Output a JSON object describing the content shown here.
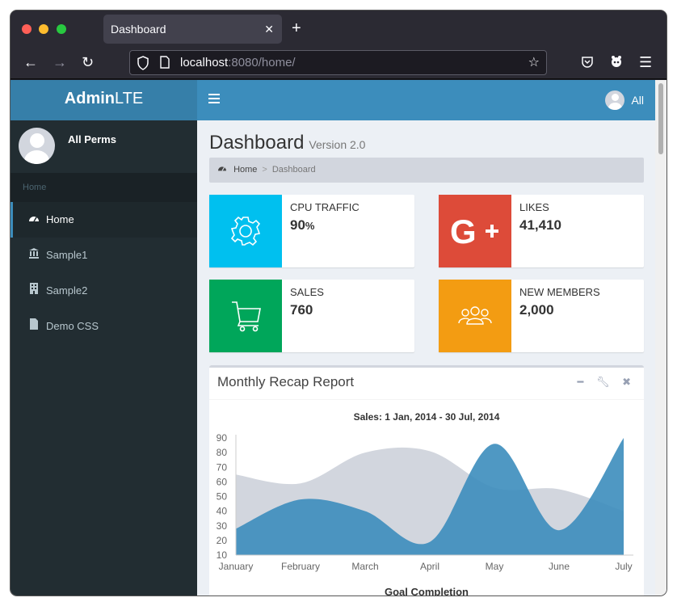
{
  "browser": {
    "tab_title": "Dashboard",
    "url_host": "localhost",
    "url_rest": ":8080/home/"
  },
  "app": {
    "logo_bold": "Admin",
    "logo_light": "LTE",
    "top_user": "All"
  },
  "sidebar": {
    "user_name": "All Perms",
    "header": "Home",
    "items": [
      {
        "label": "Home",
        "icon": "dashboard-icon",
        "active": true
      },
      {
        "label": "Sample1",
        "icon": "bank-icon",
        "active": false
      },
      {
        "label": "Sample2",
        "icon": "building-icon",
        "active": false
      },
      {
        "label": "Demo CSS",
        "icon": "file-icon",
        "active": false
      }
    ]
  },
  "content": {
    "title": "Dashboard",
    "subtitle": "Version 2.0",
    "breadcrumb": {
      "home": "Home",
      "current": "Dashboard"
    },
    "info_boxes": [
      {
        "label": "CPU TRAFFIC",
        "value": "90",
        "unit": "%",
        "color": "#00c0ef",
        "icon": "gear-icon"
      },
      {
        "label": "LIKES",
        "value": "41,410",
        "unit": "",
        "color": "#dd4b39",
        "icon": "google-plus-icon"
      },
      {
        "label": "SALES",
        "value": "760",
        "unit": "",
        "color": "#00a65a",
        "icon": "shopping-cart-icon"
      },
      {
        "label": "NEW MEMBERS",
        "value": "2,000",
        "unit": "",
        "color": "#f39c12",
        "icon": "users-icon"
      }
    ],
    "report": {
      "title": "Monthly Recap Report",
      "chart_title": "Sales: 1 Jan, 2014 - 30 Jul, 2014",
      "goal_title": "Goal Completion"
    }
  },
  "chart_data": {
    "type": "area",
    "title": "Sales: 1 Jan, 2014 - 30 Jul, 2014",
    "categories": [
      "January",
      "February",
      "March",
      "April",
      "May",
      "June",
      "July"
    ],
    "ylim": [
      10,
      90
    ],
    "yticks": [
      10,
      20,
      30,
      40,
      50,
      60,
      70,
      80,
      90
    ],
    "grid": false,
    "series": [
      {
        "color": "#d2d6de",
        "values": [
          65,
          59,
          80,
          81,
          56,
          55,
          40
        ]
      },
      {
        "color": "#3c8dbc",
        "values": [
          28,
          48,
          40,
          19,
          86,
          27,
          90
        ]
      }
    ]
  }
}
